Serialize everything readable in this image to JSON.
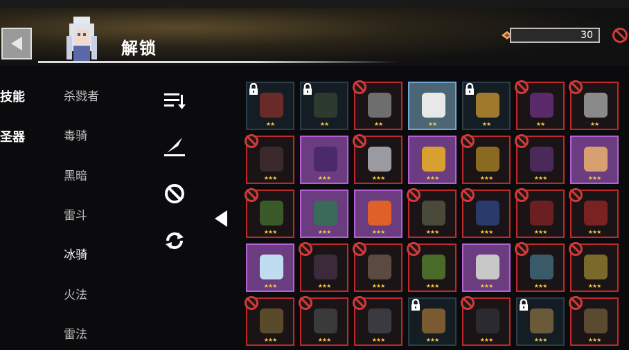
{
  "header": {
    "title": "解锁",
    "currency_value": "30"
  },
  "side_tabs": [
    {
      "label": "技能"
    },
    {
      "label": "圣器"
    }
  ],
  "classes": [
    {
      "label": "杀戮者"
    },
    {
      "label": "毒骑"
    },
    {
      "label": "黑暗"
    },
    {
      "label": "雷斗"
    },
    {
      "label": "冰骑",
      "active": true
    },
    {
      "label": "火法"
    },
    {
      "label": "雷法"
    }
  ],
  "tools": [
    {
      "name": "sort-icon"
    },
    {
      "name": "quill-icon"
    },
    {
      "name": "ban-filter-icon"
    },
    {
      "name": "refresh-icon"
    }
  ],
  "colors": {
    "banned_border": "#c0282a",
    "rare_border": "#b65fd6",
    "selected_border": "#6fa7d6",
    "star": "#f2c84b",
    "ban": "#d23a3a"
  },
  "relics": [
    [
      {
        "state": "locked",
        "stars": "★★",
        "icon": "red-bag",
        "color": "#6a2a2a"
      },
      {
        "state": "locked",
        "stars": "★★",
        "icon": "dark-branch",
        "color": "#2d3a30"
      },
      {
        "state": "banned",
        "stars": "★★",
        "icon": "grey-stone",
        "color": "#6e6e6e"
      },
      {
        "state": "selected",
        "stars": "★★",
        "icon": "letter-envelope",
        "color": "#e8e8e8"
      },
      {
        "state": "locked",
        "stars": "★★",
        "icon": "gold-ring",
        "color": "#a07a2c"
      },
      {
        "state": "banned",
        "stars": "★★",
        "icon": "dark-gem",
        "color": "#5a2a6a"
      },
      {
        "state": "banned",
        "stars": "★★",
        "icon": "pearl-shell",
        "color": "#8a8a8a"
      }
    ],
    [
      {
        "state": "banned",
        "stars": "★★★",
        "icon": "black-potion",
        "color": "#3a2a2a"
      },
      {
        "state": "purple",
        "stars": "★★★",
        "icon": "purple-card",
        "color": "#4a2a6a"
      },
      {
        "state": "banned",
        "stars": "★★★",
        "icon": "silver-rock",
        "color": "#9a9aa0"
      },
      {
        "state": "purple",
        "stars": "★★★",
        "icon": "gold-dice",
        "color": "#d8a030"
      },
      {
        "state": "banned",
        "stars": "★★★",
        "icon": "gold-chalice",
        "color": "#8a6a20"
      },
      {
        "state": "banned",
        "stars": "★★★",
        "icon": "purple-tome",
        "color": "#4a2a5a"
      },
      {
        "state": "purple",
        "stars": "★★★",
        "icon": "pink-pouch",
        "color": "#d8a070"
      }
    ],
    [
      {
        "state": "banned",
        "stars": "★★★",
        "icon": "green-scroll",
        "color": "#3a5a2a"
      },
      {
        "state": "purple",
        "stars": "★★★",
        "icon": "green-rifle",
        "color": "#3a6a5a"
      },
      {
        "state": "purple",
        "stars": "★★★",
        "icon": "fire-orb",
        "color": "#e0602a"
      },
      {
        "state": "banned",
        "stars": "★★★",
        "icon": "holy-paper",
        "color": "#4a4a3a"
      },
      {
        "state": "banned",
        "stars": "★★★",
        "icon": "blue-bars",
        "color": "#2a3a6a"
      },
      {
        "state": "banned",
        "stars": "★★★",
        "icon": "red-feather",
        "color": "#6a2020"
      },
      {
        "state": "banned",
        "stars": "★★★",
        "icon": "red-egg",
        "color": "#7a2222"
      }
    ],
    [
      {
        "state": "purple",
        "stars": "★★★",
        "icon": "ice-branch",
        "color": "#c0dcf0"
      },
      {
        "state": "banned",
        "stars": "★★★",
        "icon": "dark-moon",
        "color": "#3a2a3a"
      },
      {
        "state": "banned",
        "stars": "★★★",
        "icon": "rock-shard",
        "color": "#5a4a40"
      },
      {
        "state": "banned",
        "stars": "★★★",
        "icon": "green-cloak",
        "color": "#4a6a2a"
      },
      {
        "state": "purple",
        "stars": "★★★",
        "icon": "silver-sword",
        "color": "#c8c8c8"
      },
      {
        "state": "banned",
        "stars": "★★★",
        "icon": "frost-claw",
        "color": "#3a5a6a"
      },
      {
        "state": "banned",
        "stars": "★★★",
        "icon": "gold-coin",
        "color": "#7a6a2a"
      }
    ],
    [
      {
        "state": "banned",
        "stars": "★★★",
        "icon": "medal-cross",
        "color": "#5a4a2a"
      },
      {
        "state": "banned",
        "stars": "★★★",
        "icon": "dark-bow",
        "color": "#3a3a3a"
      },
      {
        "state": "banned",
        "stars": "★★★",
        "icon": "black-gauntlet",
        "color": "#3a3a40"
      },
      {
        "state": "locked",
        "stars": "★★★",
        "icon": "treasure-chest",
        "color": "#7a5a30"
      },
      {
        "state": "banned",
        "stars": "★★★",
        "icon": "black-claw",
        "color": "#2a2a30"
      },
      {
        "state": "locked",
        "stars": "★★★",
        "icon": "gear-wheel",
        "color": "#6a5a3a"
      },
      {
        "state": "banned",
        "stars": "★★★",
        "icon": "money-sack",
        "color": "#5a4a30"
      }
    ]
  ]
}
